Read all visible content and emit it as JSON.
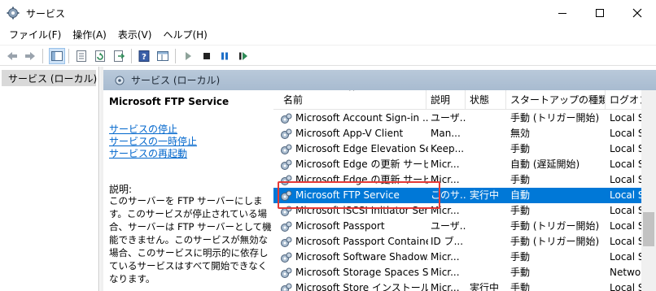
{
  "window": {
    "title": "サービス",
    "buttons": [
      "minimize-icon",
      "maximize-icon",
      "close-icon"
    ]
  },
  "menu": [
    "ファイル(F)",
    "操作(A)",
    "表示(V)",
    "ヘルプ(H)"
  ],
  "toolbar": {
    "icons": [
      "back-arrow-icon",
      "forward-arrow-icon",
      "show-hide-tree-icon",
      "properties-icon",
      "refresh-icon",
      "export-list-icon",
      "help-icon",
      "console-view-icon",
      "start-service-icon",
      "stop-service-icon",
      "pause-service-icon",
      "restart-service-icon"
    ],
    "colors": {
      "play": "#2e8b57",
      "pause": "#1e6fc8",
      "stop": "#222222"
    }
  },
  "tree": {
    "item": "サービス (ローカル)"
  },
  "pane": {
    "header": "サービス (ローカル)"
  },
  "description": {
    "service_name": "Microsoft FTP Service",
    "links": [
      "サービスの停止",
      "サービスの一時停止",
      "サービスの再起動"
    ],
    "heading": "説明:",
    "body": "このサーバーを FTP サーバーにします。このサービスが停止されている場合、サーバーは FTP サーバーとして機能できません。このサービスが無効な場合、このサービスに明示的に依存しているサービスはすべて開始できなくなります。"
  },
  "table": {
    "sort_indicator": "^",
    "columns": [
      "名前",
      "説明",
      "状態",
      "スタートアップの種類",
      "ログオン"
    ],
    "selected_color": "#0078d7",
    "rows": [
      {
        "name": "Microsoft Account Sign-in ...",
        "desc": "ユーザ...",
        "status": "",
        "startup": "手動 (トリガー開始)",
        "logon": "Local S"
      },
      {
        "name": "Microsoft App-V Client",
        "desc": "Man...",
        "status": "",
        "startup": "無効",
        "logon": "Local S"
      },
      {
        "name": "Microsoft Edge Elevation Se...",
        "desc": "Keep...",
        "status": "",
        "startup": "手動",
        "logon": "Local S"
      },
      {
        "name": "Microsoft Edge の更新 サービ...",
        "desc": "Micr...",
        "status": "",
        "startup": "自動 (遅延開始)",
        "logon": "Local S"
      },
      {
        "name": "Microsoft Edge の更新 サービ...",
        "desc": "Micr...",
        "status": "",
        "startup": "手動",
        "logon": "Local S"
      },
      {
        "name": "Microsoft FTP Service",
        "desc": "このサ...",
        "status": "実行中",
        "startup": "自動",
        "logon": "Local S",
        "selected": true
      },
      {
        "name": "Microsoft iSCSI Initiator Ser...",
        "desc": "Micr...",
        "status": "",
        "startup": "手動",
        "logon": "Local S"
      },
      {
        "name": "Microsoft Passport",
        "desc": "ユーザ...",
        "status": "",
        "startup": "手動 (トリガー開始)",
        "logon": "Local S"
      },
      {
        "name": "Microsoft Passport Container",
        "desc": "ID ブ...",
        "status": "",
        "startup": "手動 (トリガー開始)",
        "logon": "Local S"
      },
      {
        "name": "Microsoft Software Shadow...",
        "desc": "Micr...",
        "status": "",
        "startup": "手動",
        "logon": "Local S"
      },
      {
        "name": "Microsoft Storage Spaces S...",
        "desc": "Micr...",
        "status": "",
        "startup": "手動",
        "logon": "Networ"
      },
      {
        "name": "Microsoft Store インストール ...",
        "desc": "Micr...",
        "status": "実行中",
        "startup": "手動",
        "logon": "Local S"
      }
    ]
  }
}
